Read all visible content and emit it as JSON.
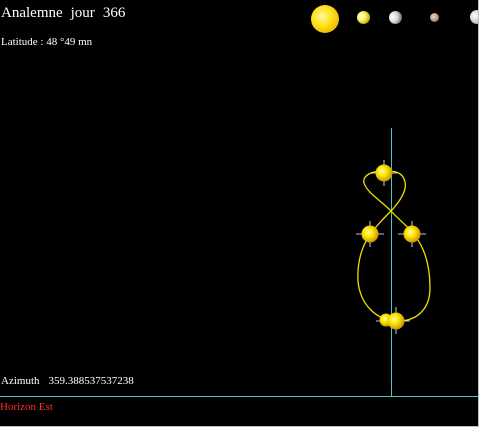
{
  "header": {
    "title_word": "Analemne",
    "day_label": "jour",
    "day_value": "366"
  },
  "latitude": {
    "text": "Latitude : 48 °49 mn"
  },
  "azimuth": {
    "label": "Azimuth",
    "value": "359.388537537238"
  },
  "horizon": {
    "label": "Horizon Est"
  },
  "planet_bar": [
    {
      "name": "sun-icon"
    },
    {
      "name": "moon-icon"
    },
    {
      "name": "mercury-icon"
    },
    {
      "name": "venus-icon"
    },
    {
      "name": "mars-icon"
    }
  ],
  "colors": {
    "background": "#000000",
    "text": "#ffffff",
    "horizon_label": "#ff2a2a",
    "horizon_line": "#49c6c6",
    "meridian_line": "#49c6c6",
    "analemma_curve": "#f0e000",
    "sun_marker": "#ffe600"
  }
}
